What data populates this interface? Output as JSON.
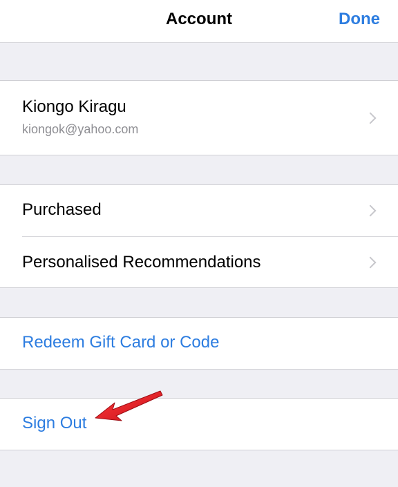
{
  "navbar": {
    "title": "Account",
    "done_label": "Done"
  },
  "account": {
    "name": "Kiongo Kiragu",
    "email": "kiongok@yahoo.com"
  },
  "menu": {
    "purchased": "Purchased",
    "recommendations": "Personalised Recommendations"
  },
  "actions": {
    "redeem": "Redeem Gift Card or Code",
    "sign_out": "Sign Out"
  },
  "colors": {
    "accent": "#2d7de0",
    "background": "#efeff4",
    "annotation_arrow": "#e8202a"
  },
  "icons": {
    "chevron": "chevron-right-icon",
    "annotation": "red-arrow-icon"
  }
}
